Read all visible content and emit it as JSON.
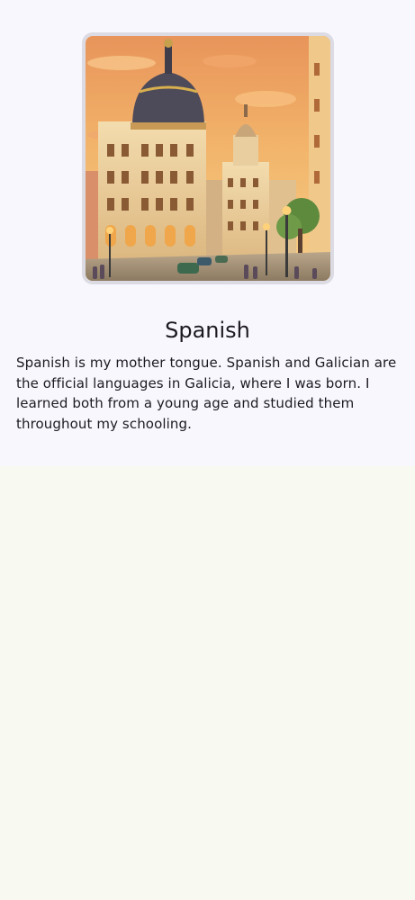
{
  "language_card": {
    "title": "Spanish",
    "description": "Spanish is my mother tongue. Spanish and Galician are the official languages in Galicia, where I was born. I learned both from a young age and studied them throughout my schooling.",
    "image_icon": "city-street-illustration",
    "colors": {
      "card_background": "#f8f7fe",
      "page_background": "#f8f9f0",
      "image_border": "#dcdbe3",
      "text": "#1d1b20"
    }
  }
}
